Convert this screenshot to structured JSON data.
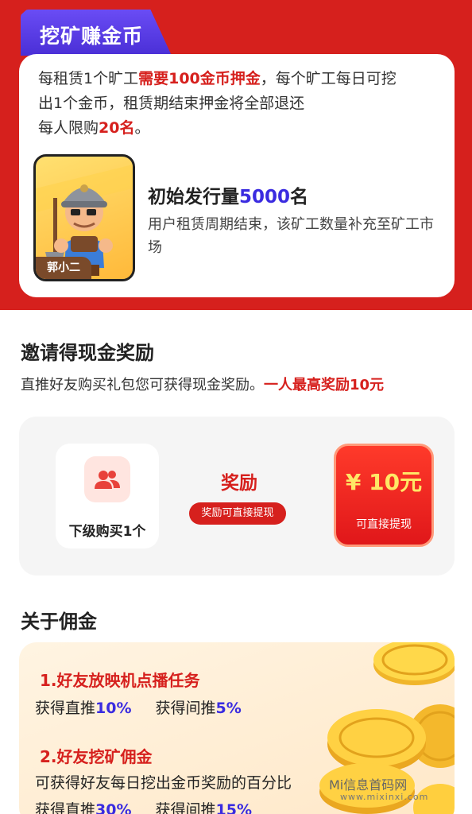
{
  "mining": {
    "tab_title": "挖矿赚金币",
    "desc": {
      "line1_a": "每租赁1个旷工",
      "line1_b": "需要100金币押金",
      "line1_c": "，每个旷工每日可挖",
      "line2": "出1个金币，租赁期结束押金将全部退还",
      "line3_a": "每人限购",
      "line3_b": "20名",
      "line3_c": "。"
    },
    "miner_name": "郭小二",
    "issue": {
      "label": "初始发行量",
      "count": "5000",
      "unit": "名",
      "sub": "用户租赁周期结束，该矿工数量补充至矿工市场"
    }
  },
  "invite": {
    "title": "邀请得现金奖励",
    "desc_a": "直推好友购买礼包您可获得现金奖励。",
    "desc_b": "一人最高奖励10元",
    "level_text": "下级购买1个",
    "reward_label": "奖励",
    "reward_pill": "奖励可直接提现",
    "amount": "¥ 10元",
    "amount_sub": "可直接提现"
  },
  "commission": {
    "title": "关于佣金",
    "item1": {
      "head": "1.好友放映机点播任务",
      "a": "获得直推",
      "a_val": "10%",
      "b": "获得间推",
      "b_val": "5%"
    },
    "item2": {
      "head": "2.好友挖矿佣金",
      "desc": "可获得好友每日挖出金币奖励的百分比",
      "a": "获得直推",
      "a_val": "30%",
      "b": "获得间推",
      "b_val": "15%"
    }
  },
  "watermark": {
    "text": "Mi信息首码网",
    "url": "www.mixinxi.com"
  },
  "colors": {
    "brand_red": "#d6201d",
    "accent_blue": "#3a2be0",
    "gold": "#ffe766"
  }
}
